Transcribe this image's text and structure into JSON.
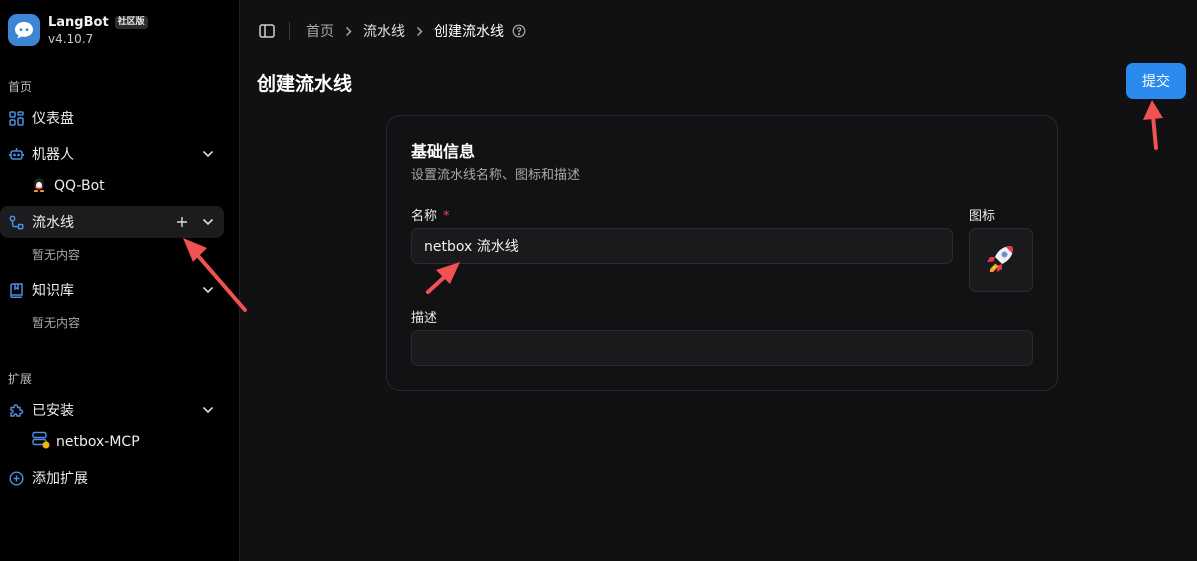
{
  "brand": {
    "name": "LangBot",
    "badge": "社区版",
    "version": "v4.10.7"
  },
  "sidebar": {
    "section_home": "首页",
    "dashboard": "仪表盘",
    "bots": "机器人",
    "bot_items": [
      "QQ-Bot"
    ],
    "pipelines": "流水线",
    "pipelines_empty": "暂无内容",
    "knowledge": "知识库",
    "knowledge_empty": "暂无内容",
    "section_ext": "扩展",
    "installed": "已安装",
    "installed_items": [
      "netbox-MCP"
    ],
    "add_extension": "添加扩展"
  },
  "breadcrumb": [
    "首页",
    "流水线",
    "创建流水线"
  ],
  "page": {
    "title": "创建流水线",
    "submit": "提交"
  },
  "card": {
    "title": "基础信息",
    "desc": "设置流水线名称、图标和描述",
    "name_label": "名称",
    "required_mark": "*",
    "name_value": "netbox 流水线",
    "icon_label": "图标",
    "icon": "rocket-emoji",
    "desc_label": "描述",
    "desc_value": ""
  },
  "colors": {
    "accent": "#2b8aee",
    "annotation": "#f05252",
    "nav_icon": "#4a8fe0"
  }
}
